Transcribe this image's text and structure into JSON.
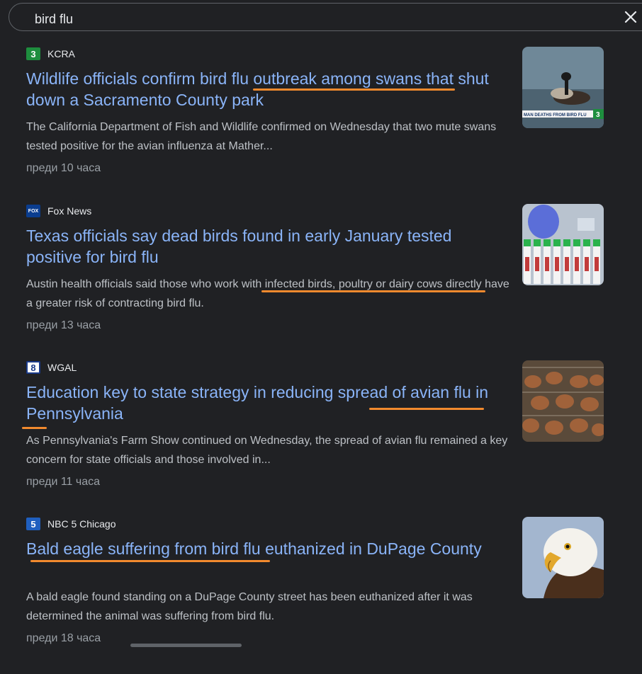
{
  "search": {
    "query": "bird flu"
  },
  "articles": [
    {
      "source": "KCRA",
      "logo_text": "3",
      "headline": "Wildlife officials confirm bird flu outbreak among swans that shut down a Sacramento County park",
      "snippet": "The California Department of Fish and Wildlife confirmed on Wednesday that two mute swans tested positive for the avian influenza at Mather...",
      "time": "преди 10 часа",
      "thumb_caption": "MAN DEATHS FROM BIRD FLU",
      "thumb_logo": "3"
    },
    {
      "source": "Fox News",
      "logo_text": "FOX",
      "headline": "Texas officials say dead birds found in early January tested positive for bird flu",
      "snippet": "Austin health officials said those who work with infected birds, poultry or dairy cows directly have a greater risk of contracting bird flu.",
      "time": "преди 13 часа"
    },
    {
      "source": "WGAL",
      "logo_text": "8",
      "headline": "Education key to state strategy in reducing spread of avian flu in Pennsylvania",
      "snippet": "As Pennsylvania's Farm Show continued on Wednesday, the spread of avian flu remained a key concern for state officials and those involved in...",
      "time": "преди 11 часа"
    },
    {
      "source": "NBC 5 Chicago",
      "logo_text": "5",
      "headline": "Bald eagle suffering from bird flu euthanized in DuPage County",
      "snippet": "A bald eagle found standing on a DuPage County street has been euthanized after it was determined the animal was suffering from bird flu.",
      "time": "преди 18 часа"
    }
  ],
  "colors": {
    "background": "#202124",
    "link": "#8ab4f8",
    "annotation": "#f28a2e"
  }
}
